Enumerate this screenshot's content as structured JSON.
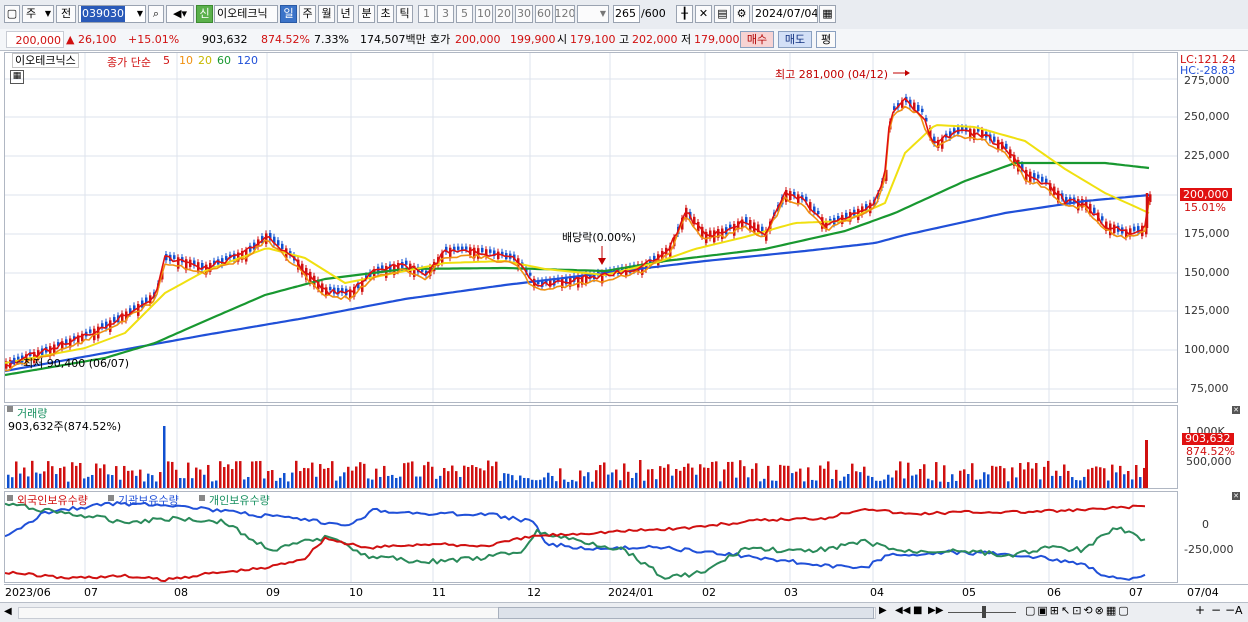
{
  "toolbar": {
    "period_type": "주",
    "prev_label": "전",
    "code": "039030",
    "badge": "신",
    "name": "이오테크닉",
    "tf_day": "일",
    "tf_week": "주",
    "tf_month": "월",
    "tf_year": "년",
    "tf_minute": "분",
    "tf_sec": "초",
    "tf_tick": "틱",
    "intervals": [
      "1",
      "3",
      "5",
      "10",
      "20",
      "30",
      "60",
      "120"
    ],
    "count": "265",
    "count_total": "/600",
    "date": "2024/07/04"
  },
  "quote": {
    "price": "200,000",
    "change": "▲ 26,100",
    "change_pct": "+15.01%",
    "volume": "903,632",
    "vol_ratio": "874.52%",
    "turnover_rate": "7.33%",
    "amount": "174,507백만",
    "ask_label": "호가",
    "ask1": "200,000",
    "ask2": "199,900",
    "open_label": "시",
    "open": "179,100",
    "high_label": "고",
    "high": "202,000",
    "low_label": "저",
    "low": "179,000",
    "buy_label": "매수",
    "sell_label": "매도",
    "eval_label": "평"
  },
  "price_panel": {
    "stock_name": "이오테크닉스",
    "ma_type": "종가 단순",
    "ma_periods": [
      "5",
      "10",
      "20",
      "60",
      "120"
    ],
    "max_annotation": "최고 281,000 (04/12)",
    "min_annotation": "최저 90,400 (06/07)",
    "dividend_annotation": "배당락(0.00%)",
    "lc": "LC:121.24",
    "hc": "HC:-28.83",
    "price_tag": "200,000",
    "pct_tag": "15.01%",
    "axis": [
      "275,000",
      "250,000",
      "225,000",
      "200,000",
      "175,000",
      "150,000",
      "125,000",
      "100,000",
      "75,000"
    ]
  },
  "volume_panel": {
    "title": "거래량",
    "value": "903,632주(874.52%)",
    "tag_value": "903,632",
    "tag_pct": "874.52%",
    "axis": [
      "1,000K",
      "500,000"
    ]
  },
  "holdings_panel": {
    "foreign": "외국인보유수량",
    "inst": "기관보유수량",
    "indiv": "개인보유수량",
    "axis": [
      "0",
      "-250,000"
    ]
  },
  "x_axis": [
    "2023/06",
    "07",
    "08",
    "09",
    "10",
    "11",
    "12",
    "2024/01",
    "02",
    "03",
    "04",
    "05",
    "06",
    "07",
    "07/04"
  ],
  "colors": {
    "ma5": "#e01010",
    "ma10": "#f09010",
    "ma20": "#f0e010",
    "ma60": "#189830",
    "ma120": "#2050d8",
    "up": "#d01010",
    "down": "#1050d0"
  }
}
